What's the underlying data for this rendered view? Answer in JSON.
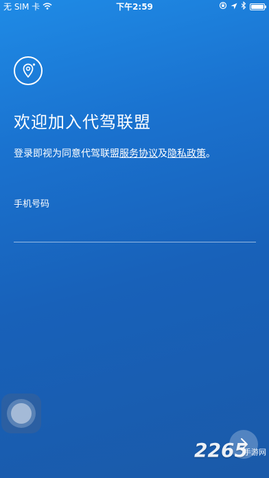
{
  "status_bar": {
    "carrier": "无 SIM 卡",
    "time": "下午2:59",
    "battery_level": 1.0
  },
  "login": {
    "title": "欢迎加入代驾联盟",
    "agreement_prefix": "登录即视为同意代驾联盟",
    "service_agreement_link": "服务协议",
    "conjunction": "及",
    "privacy_policy_link": "隐私政策",
    "period": "。",
    "phone_label": "手机号码",
    "phone_value": "",
    "phone_placeholder": ""
  },
  "watermark": {
    "number": "2265",
    "text": "手游网"
  },
  "colors": {
    "background_top": "#1f8be6",
    "background_bottom": "#1a5aa9",
    "foreground": "#ffffff"
  },
  "icons": {
    "logo": "location-pin-icon",
    "next": "chevron-right-icon",
    "assistive": "assistive-touch-icon"
  }
}
